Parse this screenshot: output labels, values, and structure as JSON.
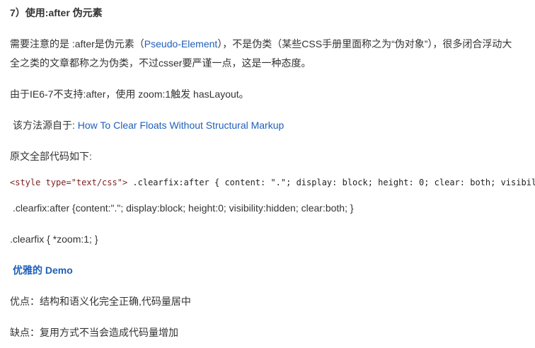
{
  "heading": "7）使用:after 伪元素",
  "para1": {
    "line1_pre": "需要注意的是 :after是伪元素（",
    "link": "Pseudo-Element",
    "line1_post": "），不是伪类（某些CSS手册里面称之为“伪对象”），很多闭合浮动大",
    "line2": "全之类的文章都称之为伪类，不过csser要严谨一点，这是一种态度。"
  },
  "para2": "由于IE6-7不支持:after，使用 zoom:1触发 hasLayout。",
  "source": {
    "prefix": "该方法源自于: ",
    "link": "How To Clear Floats Without Structural Markup"
  },
  "code_intro": "原文全部代码如下:",
  "code": {
    "tag": "<style type=\"text/css\">",
    "rest": "  .clearfix:after {  content: \".\"; display: block; height: 0; clear: both; visibil"
  },
  "css_line1": ".clearfix:after {content:\".\"; display:block; height:0; visibility:hidden; clear:both; }",
  "css_line2": ".clearfix { *zoom:1; }",
  "demo_heading": "优雅的 Demo",
  "pros": "优点：结构和语义化完全正确,代码量居中",
  "cons": "缺点：复用方式不当会造成代码量增加"
}
